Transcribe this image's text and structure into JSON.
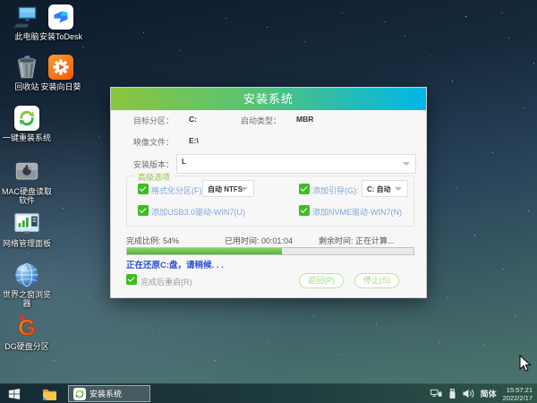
{
  "desktop": {
    "icons": [
      {
        "label": "此电脑"
      },
      {
        "label": "安装ToDesk"
      },
      {
        "label": "回收站"
      },
      {
        "label": "安装向日葵"
      },
      {
        "label": "一键重装系统"
      },
      {
        "label": "MAC硬盘读取软件"
      },
      {
        "label": "网络管理面板"
      },
      {
        "label": "世界之窗浏览器"
      },
      {
        "label": "DG硬盘分区"
      }
    ]
  },
  "dialog": {
    "title": "安装系统",
    "fields": {
      "target_partition_label": "目标分区：",
      "target_partition_value": "C:",
      "boot_type_label": "启动类型：",
      "boot_type_value": "MBR",
      "image_file_label": "映像文件：",
      "image_file_value": "E:\\",
      "install_version_label": "安装版本：",
      "install_version_value": "L"
    },
    "advanced": {
      "group_title": "高级选项",
      "format_partition_label": "格式化分区(F):",
      "format_partition_value": "自动 NTFS",
      "add_boot_label": "添加引导(G):",
      "add_boot_value": "C: 自动",
      "usb3_label": "添加USB3.0驱动-WIN7(U)",
      "nvme_label": "添加NVME驱动-WIN7(N)"
    },
    "progress": {
      "percent_label": "完成比例: 54%",
      "elapsed_label": "已用时间: 00:01:04",
      "remaining_label": "剩余时间: 正在计算...",
      "percent": 54,
      "percent_width": "54%",
      "status_text": "正在还原C:盘，请稍候. . .",
      "restart_label": "完成后重启(R)"
    },
    "buttons": {
      "back": "返回(P)",
      "stop": "停止(S)"
    }
  },
  "taskbar": {
    "task_label": "安装系统",
    "tray": {
      "ime": "简体",
      "time": "15:57:21",
      "date": "2022/2/17"
    }
  },
  "colors": {
    "header_gradient_left": "#8bc53f",
    "header_gradient_right": "#00b6e9",
    "checkbox_green": "#3dbd23",
    "progress_green": "#53b13a",
    "status_blue": "#2b50d0",
    "taskbar_dark": "#152a34"
  }
}
